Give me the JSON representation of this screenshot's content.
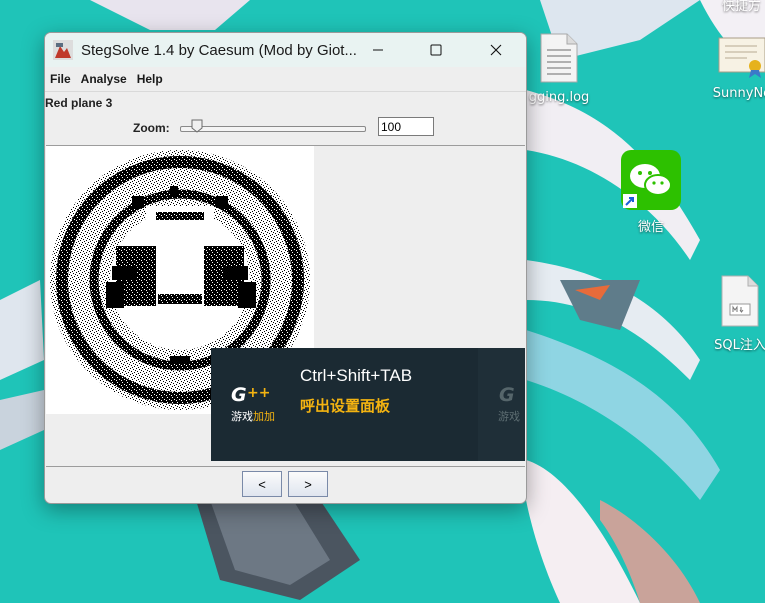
{
  "desktop": {
    "top_partial_label": "快捷方",
    "icons": [
      {
        "id": "log-file",
        "label": "gging.log"
      },
      {
        "id": "sunny",
        "label": "SunnyNe"
      },
      {
        "id": "wechat",
        "label": "微信"
      },
      {
        "id": "sql",
        "label": "SQL注入"
      }
    ]
  },
  "window": {
    "title": "StegSolve 1.4 by Caesum (Mod by Giot...",
    "menu": [
      "File",
      "Analyse",
      "Help"
    ],
    "plane_label": "Red plane 3",
    "zoom_label": "Zoom:",
    "zoom_value": "100",
    "zoom_slider_fraction": 0.09,
    "prev_label": "<",
    "next_label": ">"
  },
  "overlay": {
    "hotkey": "Ctrl+Shift+TAB",
    "subtitle": "呼出设置面板",
    "logo": "G++",
    "logo_caption_left": "游戏",
    "logo_caption_accent": "加加"
  },
  "colors": {
    "desktop_bg": "#1fc4b8",
    "overlay_bg": "#1b2a33",
    "overlay_accent": "#f3b311",
    "wechat_green": "#2dc100"
  }
}
